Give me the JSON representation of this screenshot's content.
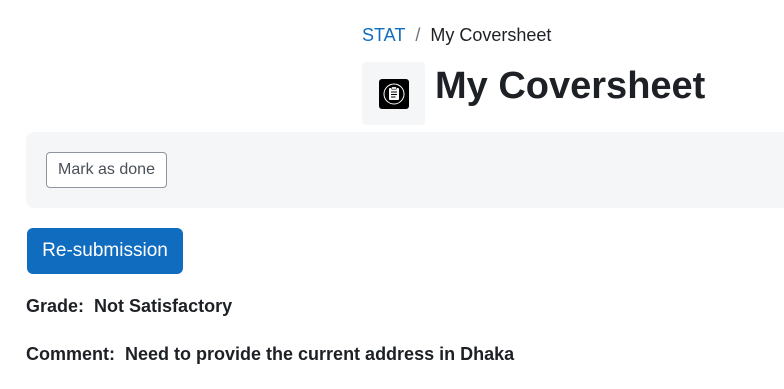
{
  "breadcrumb": {
    "parent": "STAT",
    "separator": "/",
    "current": "My Coversheet"
  },
  "page": {
    "title": "My Coversheet",
    "icon": "document-icon"
  },
  "completion": {
    "mark_done_label": "Mark as done"
  },
  "actions": {
    "resubmission_label": "Re-submission"
  },
  "feedback": {
    "grade_label": "Grade:",
    "grade_value": "Not Satisfactory",
    "comment_label": "Comment:",
    "comment_value": "Need to provide the current address in Dhaka"
  },
  "colors": {
    "accent": "#0f6cbf",
    "panel_bg": "#f5f6f8",
    "text": "#1d2125"
  }
}
